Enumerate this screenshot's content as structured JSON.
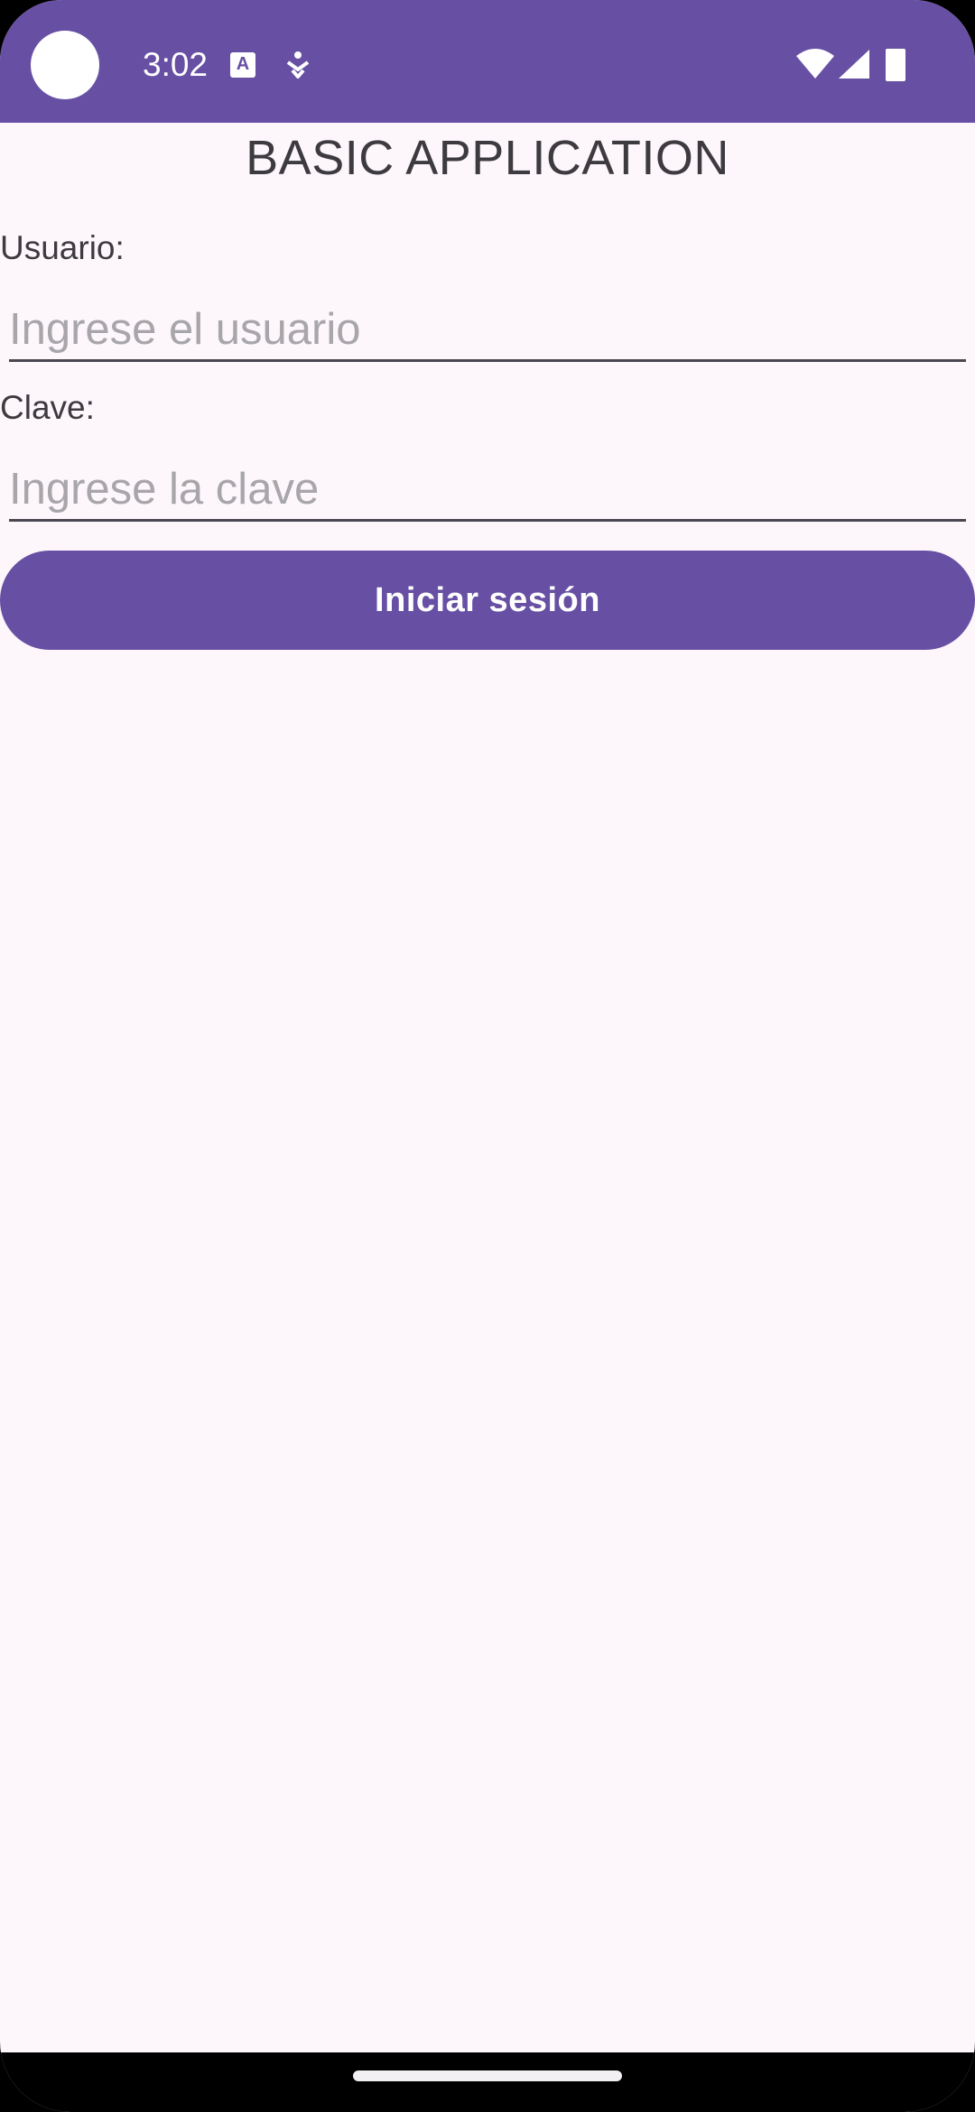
{
  "status_bar": {
    "time": "3:02",
    "notification_icons": [
      "text-a-icon",
      "accessibility-icon"
    ],
    "system_icons": [
      "wifi-icon",
      "cell-signal-icon",
      "battery-icon"
    ],
    "background_color": "#6750a4"
  },
  "app": {
    "title": "BASIC APPLICATION"
  },
  "form": {
    "user_label": "Usuario:",
    "user_value": "",
    "user_placeholder": "Ingrese el usuario",
    "password_label": "Clave:",
    "password_value": "",
    "password_placeholder": "Ingrese la clave",
    "submit_label": "Iniciar sesión"
  },
  "colors": {
    "primary": "#6750a4",
    "background": "#fdf7fb",
    "text": "#3d3a40",
    "placeholder": "#a8a6ab"
  }
}
